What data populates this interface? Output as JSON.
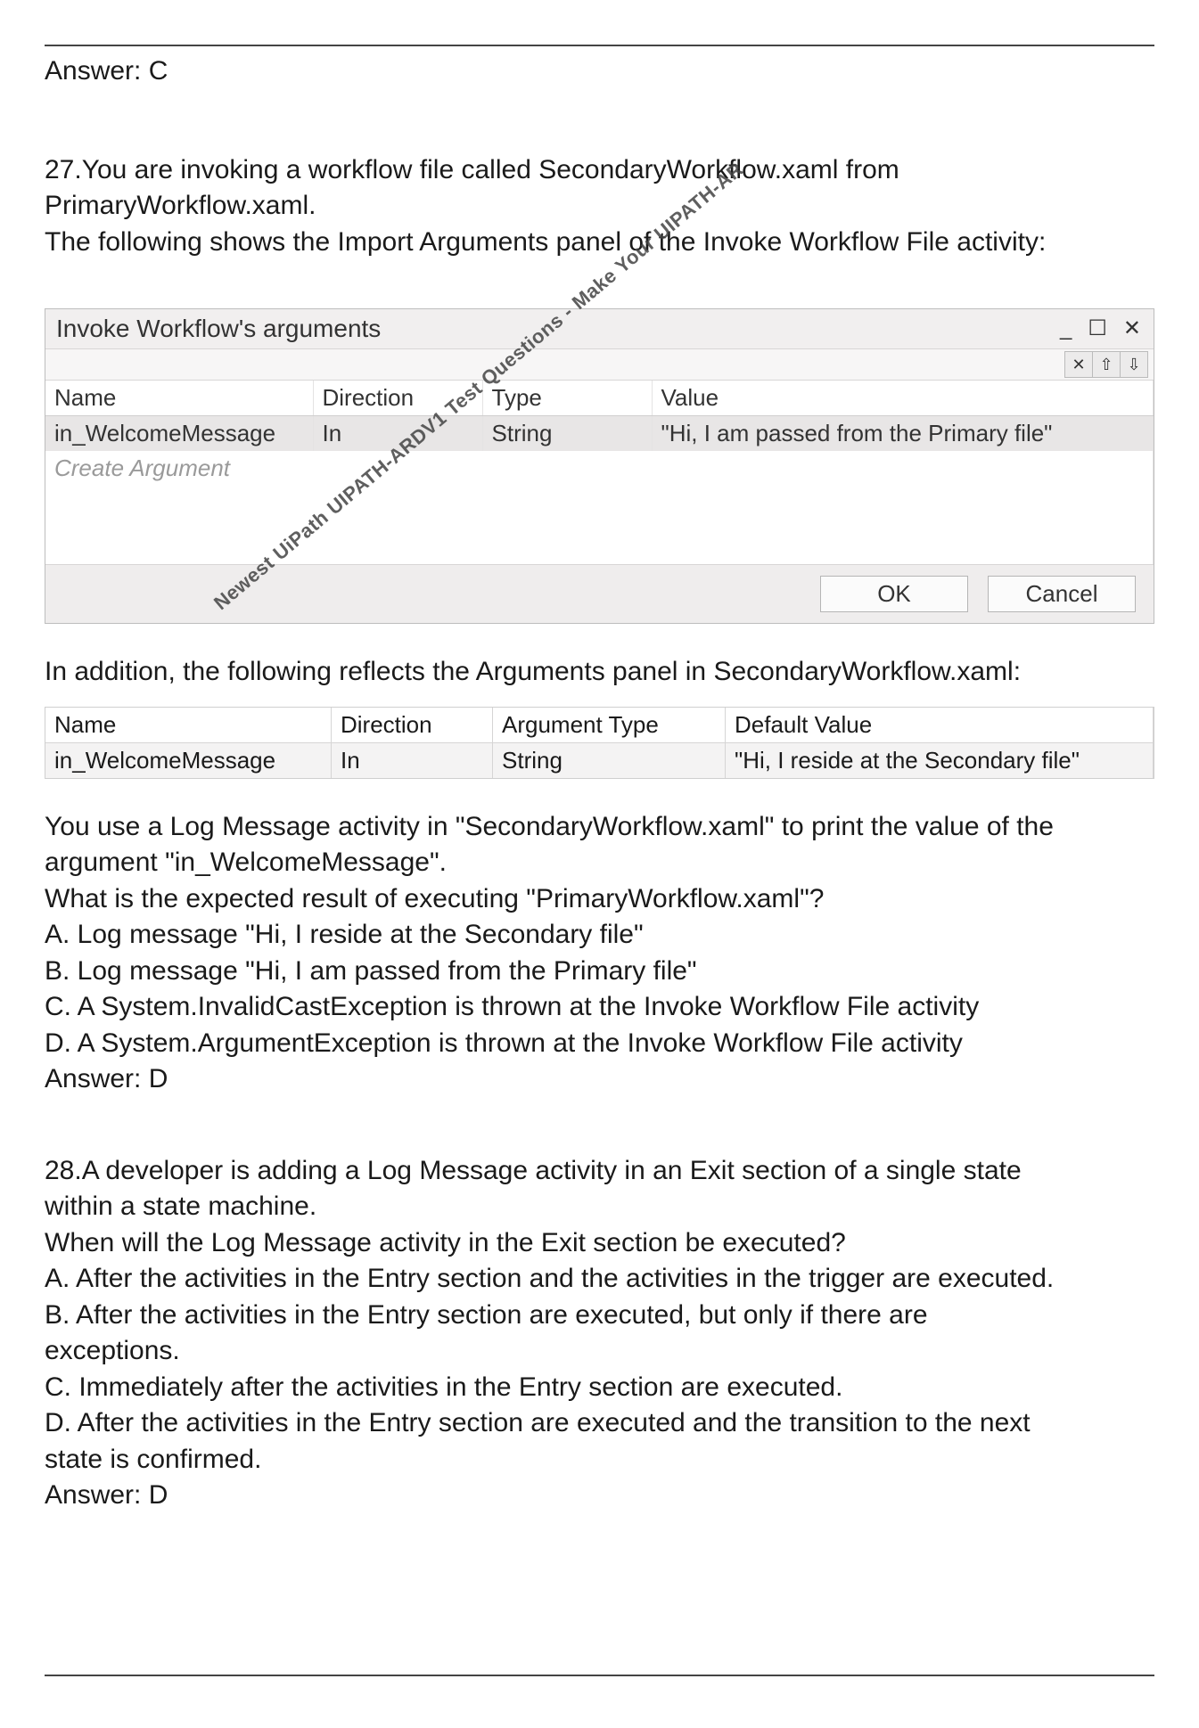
{
  "rule_top": {},
  "prev_answer": "Answer: C",
  "q27": {
    "number": "27.",
    "intro_line1": "27.You are invoking a workflow file called SecondaryWorkflow.xaml from",
    "intro_line2": "PrimaryWorkflow.xaml.",
    "intro_line3": "The following shows the Import Arguments panel of the Invoke Workflow File activity:",
    "dialog": {
      "title": "Invoke Workflow's arguments",
      "win_minimize": "_",
      "win_maximize": "☐",
      "win_close": "✕",
      "tool_delete": "✕",
      "tool_up": "⇧",
      "tool_down": "⇩",
      "headers": {
        "name": "Name",
        "direction": "Direction",
        "type": "Type",
        "value": "Value"
      },
      "row": {
        "name": "in_WelcomeMessage",
        "direction": "In",
        "type": "String",
        "value": "\"Hi, I am passed from the Primary file\""
      },
      "create_argument": "Create Argument",
      "ok": "OK",
      "cancel": "Cancel"
    },
    "mid_text": "In addition, the following reflects the Arguments panel in SecondaryWorkflow.xaml:",
    "panel2": {
      "headers": {
        "name": "Name",
        "direction": "Direction",
        "type": "Argument Type",
        "value": "Default Value"
      },
      "row": {
        "name": "in_WelcomeMessage",
        "direction": "In",
        "type": "String",
        "value": "\"Hi, I reside at the Secondary file\""
      }
    },
    "after_panel_line1": "You use a Log Message activity in \"SecondaryWorkflow.xaml\" to print the value of the",
    "after_panel_line2": "argument \"in_WelcomeMessage\".",
    "after_panel_line3": "What is the expected result of executing \"PrimaryWorkflow.xaml\"?",
    "optA": "A. Log message \"Hi, I reside at the Secondary file\"",
    "optB": "B. Log message \"Hi, I am passed from the Primary file\"",
    "optC": "C. A System.InvalidCastException is thrown at the Invoke Workflow File activity",
    "optD": "D. A System.ArgumentException is thrown at the Invoke Workflow File activity",
    "answer": "Answer: D"
  },
  "q28": {
    "intro_line1": "28.A developer is adding a Log Message activity in an Exit section of a single state",
    "intro_line2": "within a state machine.",
    "intro_line3": "When will the Log Message activity in the Exit section be executed?",
    "optA": "A. After the activities in the Entry section and the activities in the trigger are executed.",
    "optB_line1": "B. After the activities in the Entry section are executed, but only if there are",
    "optB_line2": "exceptions.",
    "optC": "C. Immediately after the activities in the Entry section are executed.",
    "optD_line1": "D. After the activities in the Entry section are executed and the transition to the next",
    "optD_line2": "state is confirmed.",
    "answer": "Answer: D"
  },
  "watermark": "Newest UiPath UIPATH-ARDV1 Test Questions - Make Your UIPATH-AR"
}
